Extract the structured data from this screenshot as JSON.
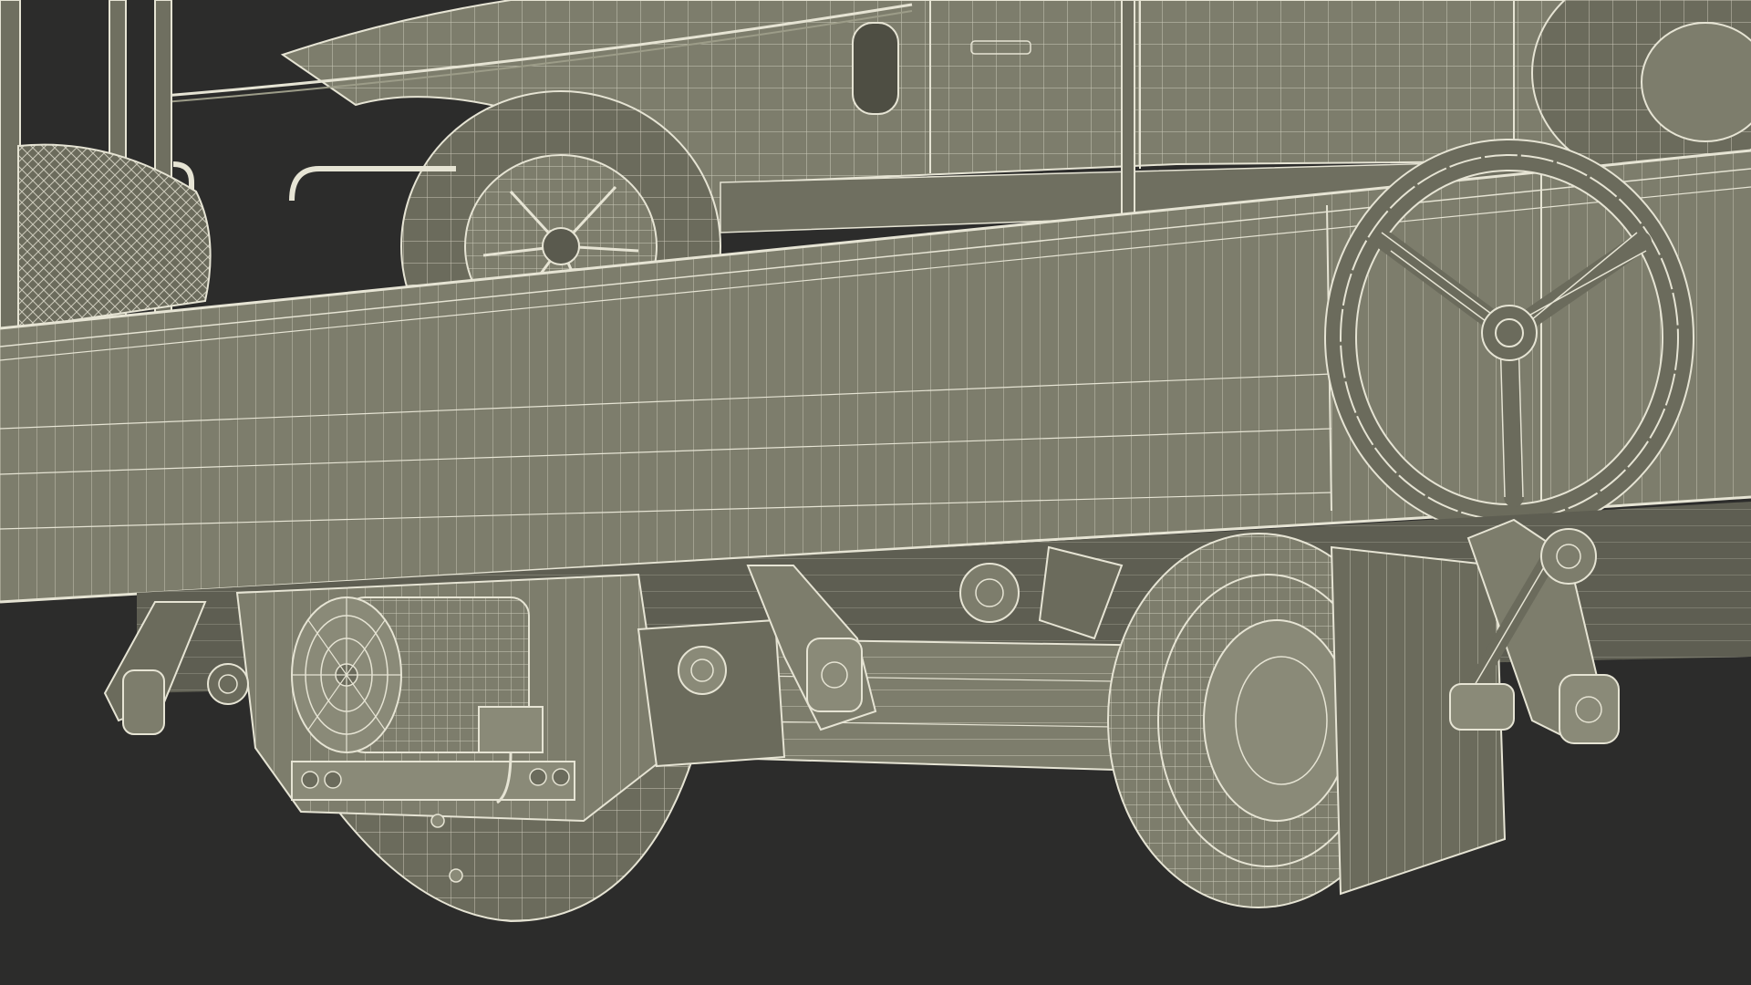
{
  "scene": {
    "background_color": "#2c2c2b",
    "surface_color": "#7d7d6c",
    "wire_color": "#e6e4d4",
    "shadow_color": "#4e4e43"
  }
}
